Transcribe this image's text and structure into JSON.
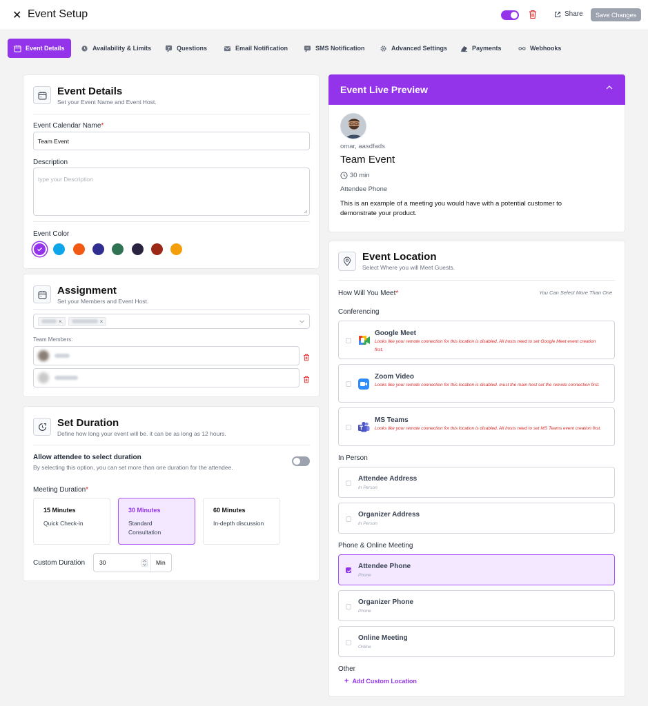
{
  "header": {
    "title": "Event Setup",
    "share_label": "Share",
    "save_label": "Save Changes"
  },
  "tabs": [
    {
      "label": "Event Details",
      "icon": "calendar-icon"
    },
    {
      "label": "Availability & Limits",
      "icon": "clock-icon"
    },
    {
      "label": "Questions",
      "icon": "question-icon"
    },
    {
      "label": "Email Notification",
      "icon": "email-icon"
    },
    {
      "label": "SMS Notification",
      "icon": "sms-icon"
    },
    {
      "label": "Advanced Settings",
      "icon": "gear-icon"
    },
    {
      "label": "Payments",
      "icon": "payment-icon"
    },
    {
      "label": "Webhooks",
      "icon": "webhook-icon"
    }
  ],
  "event_details": {
    "title": "Event Details",
    "subtitle": "Set your Event Name and Event Host.",
    "name_label": "Event Calendar Name",
    "name_value": "Team Event",
    "description_label": "Description",
    "description_placeholder": "type your Description",
    "color_label": "Event Color",
    "colors": [
      "#9333ea",
      "#0ea5e9",
      "#f05a14",
      "#312e91",
      "#2f7353",
      "#2a2440",
      "#9b2915",
      "#f59e0b"
    ]
  },
  "assignment": {
    "title": "Assignment",
    "subtitle": "Set your Members and Event Host.",
    "team_members_label": "Team Members:"
  },
  "duration": {
    "title": "Set Duration",
    "subtitle": "Define how long your event will be. it can be as long as 12 hours.",
    "allow_label": "Allow attendee to select duration",
    "allow_desc": "By selecting this option, you can set more than one duration for the attendee.",
    "meeting_label": "Meeting Duration",
    "options": [
      {
        "title": "15 Minutes",
        "desc": "Quick Check-in"
      },
      {
        "title": "30 Minutes",
        "desc": "Standard Consultation"
      },
      {
        "title": "60 Minutes",
        "desc": "In-depth discussion"
      }
    ],
    "custom_label": "Custom Duration",
    "custom_value": "30",
    "custom_unit": "Min"
  },
  "preview": {
    "title": "Event Live Preview",
    "host": "omar, aasdfads",
    "event_name": "Team Event",
    "duration": "30 min",
    "location": "Attendee Phone",
    "description": "This is an example of a meeting you would have with a potential customer to demonstrate your product."
  },
  "location": {
    "title": "Event Location",
    "subtitle": "Select Where you will Meet Guests.",
    "how_label": "How Will You Meet",
    "select_more": "You Can Select More Than One",
    "conferencing_label": "Conferencing",
    "conferencing": [
      {
        "title": "Google Meet",
        "warning": "Looks like your remote connection for this location is disabled. All hosts need to set Google Meet event creation first."
      },
      {
        "title": "Zoom Video",
        "warning": "Looks like your remote connection for this location is disabled. must the main host set the remote connection first."
      },
      {
        "title": "MS Teams",
        "warning": "Looks like your remote connection for this location is disabled. All hosts need to set MS Teams event creation first."
      }
    ],
    "in_person_label": "In Person",
    "in_person": [
      {
        "title": "Attendee Address",
        "sub": "In Person"
      },
      {
        "title": "Organizer Address",
        "sub": "In Person"
      }
    ],
    "phone_label": "Phone & Online Meeting",
    "phone": [
      {
        "title": "Attendee Phone",
        "sub": "Phone"
      },
      {
        "title": "Organizer Phone",
        "sub": "Phone"
      },
      {
        "title": "Online Meeting",
        "sub": "Online"
      }
    ],
    "other_label": "Other",
    "add_custom": "Add Custom Location"
  }
}
